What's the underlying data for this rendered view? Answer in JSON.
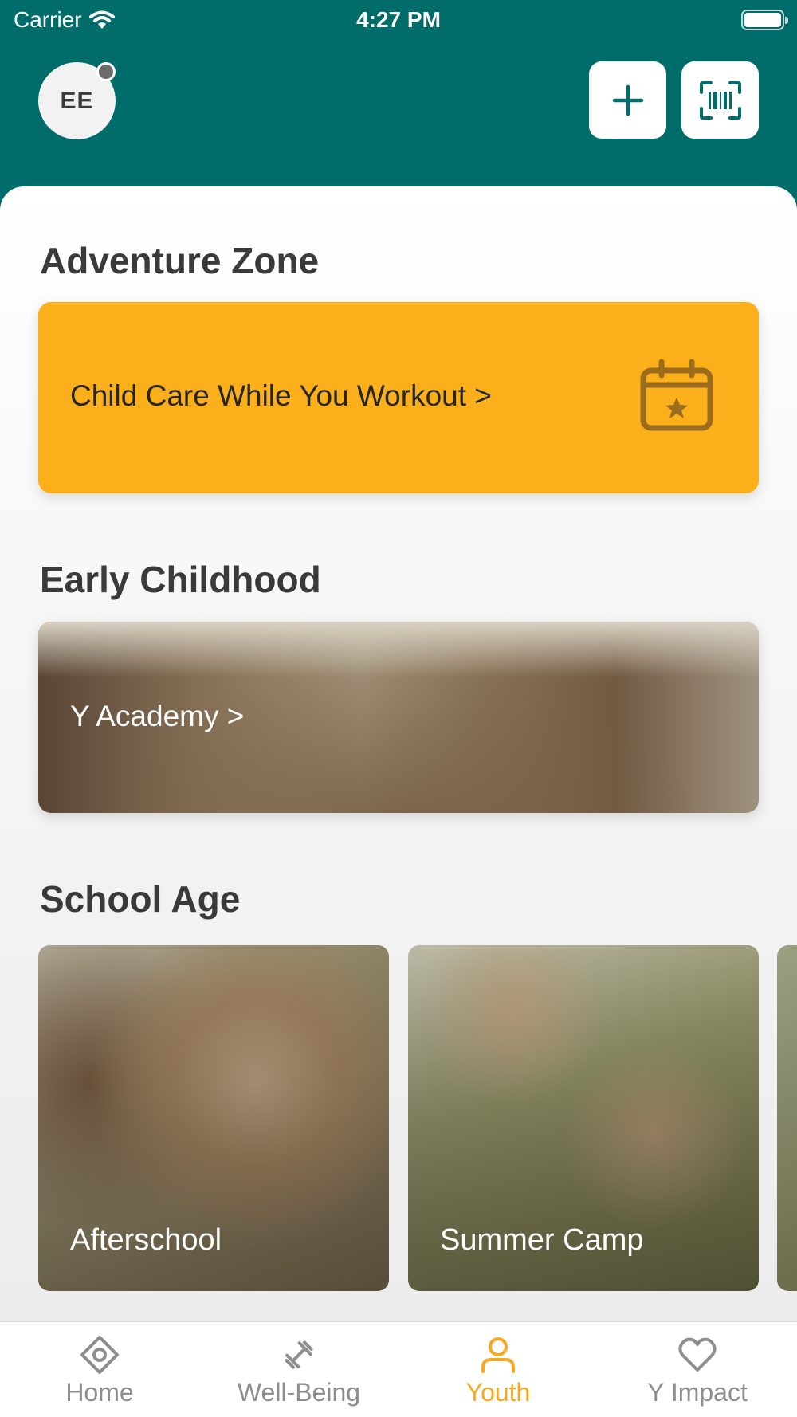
{
  "status_bar": {
    "carrier": "Carrier",
    "time": "4:27 PM"
  },
  "header": {
    "avatar_initials": "EE"
  },
  "sections": {
    "adventure_zone": {
      "title": "Adventure Zone",
      "card_label": "Child Care While You Workout >"
    },
    "early_childhood": {
      "title": "Early Childhood",
      "card_label": "Y Academy >"
    },
    "school_age": {
      "title": "School Age",
      "cards": [
        {
          "label": "Afterschool"
        },
        {
          "label": "Summer Camp"
        }
      ]
    }
  },
  "tabs": [
    {
      "label": "Home",
      "icon": "home-diamond-icon"
    },
    {
      "label": "Well-Being",
      "icon": "dumbbell-icon"
    },
    {
      "label": "Youth",
      "icon": "person-icon",
      "active": true
    },
    {
      "label": "Y Impact",
      "icon": "heart-icon"
    }
  ],
  "colors": {
    "brand_teal": "#016d6b",
    "accent_orange": "#fbaf1b",
    "active_tab": "#f7a823"
  }
}
